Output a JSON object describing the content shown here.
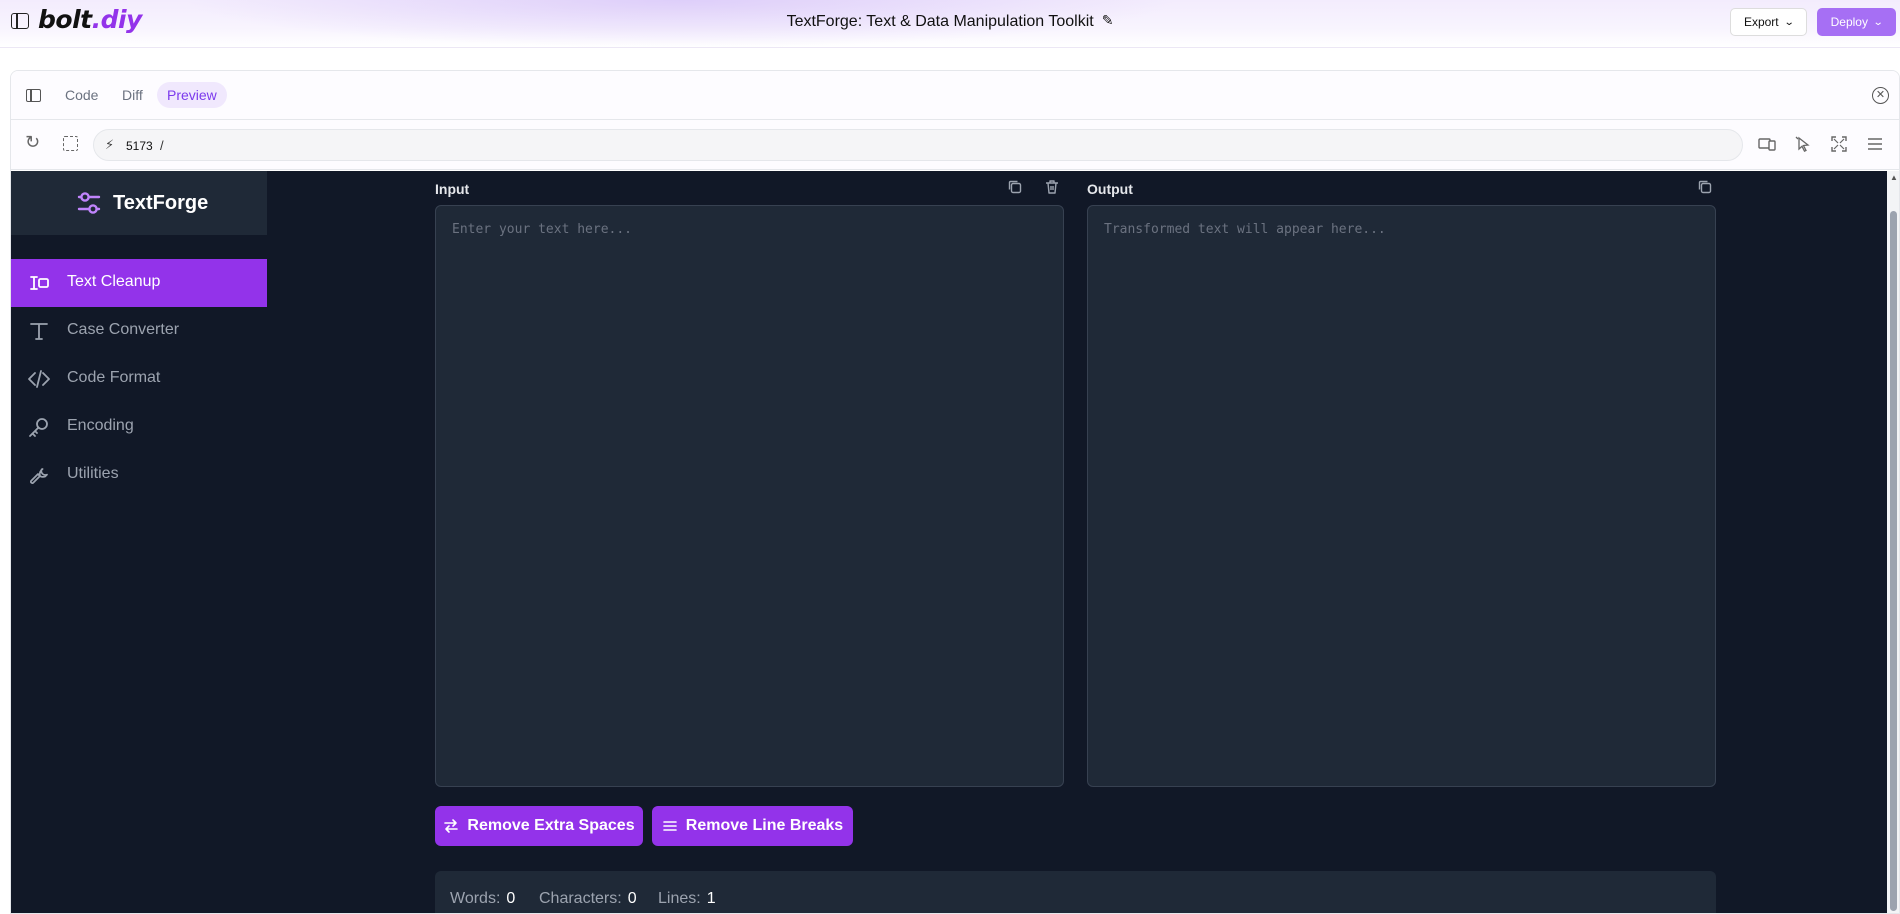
{
  "header": {
    "logo_part1": "bolt",
    "logo_part2": ".diy",
    "project_title": "TextForge: Text & Data Manipulation Toolkit",
    "export_label": "Export",
    "deploy_label": "Deploy"
  },
  "workbench": {
    "tabs": [
      {
        "label": "Code",
        "active": false
      },
      {
        "label": "Diff",
        "active": false
      },
      {
        "label": "Preview",
        "active": true
      }
    ],
    "port": "5173",
    "path": "/"
  },
  "app": {
    "brand": "TextForge",
    "nav": [
      {
        "label": "Text Cleanup",
        "icon": "text-cleanup-icon",
        "active": true
      },
      {
        "label": "Case Converter",
        "icon": "type-icon",
        "active": false
      },
      {
        "label": "Code Format",
        "icon": "code-icon",
        "active": false
      },
      {
        "label": "Encoding",
        "icon": "key-icon",
        "active": false
      },
      {
        "label": "Utilities",
        "icon": "wrench-icon",
        "active": false
      }
    ],
    "input_label": "Input",
    "input_placeholder": "Enter your text here...",
    "input_value": "",
    "output_label": "Output",
    "output_placeholder": "Transformed text will appear here...",
    "output_value": "",
    "actions": [
      {
        "label": "Remove Extra Spaces",
        "icon": "swap-arrows-icon"
      },
      {
        "label": "Remove Line Breaks",
        "icon": "menu-lines-icon"
      }
    ],
    "stats": {
      "words_label": "Words:",
      "words": "0",
      "chars_label": "Characters:",
      "chars": "0",
      "lines_label": "Lines:",
      "lines": "1"
    }
  },
  "colors": {
    "accent": "#9333ea",
    "deploy_button": "#a66ff4",
    "app_bg": "#111827",
    "panel_bg": "#1f2937"
  }
}
